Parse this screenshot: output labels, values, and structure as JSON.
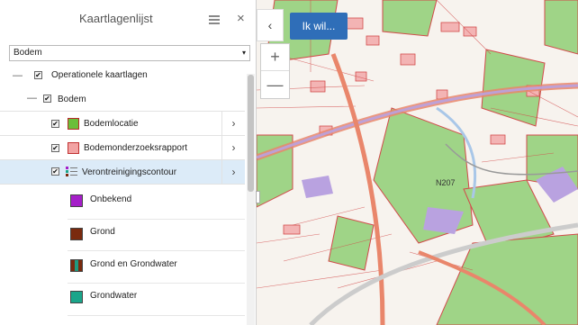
{
  "panel": {
    "title": "Kaartlagenlijst",
    "menu_icon": "menu-icon",
    "close_icon": "close-icon",
    "close_glyph": "×"
  },
  "select": {
    "value": "Bodem",
    "caret": "▾"
  },
  "tree": {
    "root": {
      "label": "Operationele kaartlagen",
      "checked": "✔"
    },
    "group": {
      "label": "Bodem",
      "checked": "✔"
    },
    "layers": [
      {
        "label": "Bodemlocatie",
        "checked": "✔",
        "color": "#6abf3a",
        "border": "#b8282a"
      },
      {
        "label": "Bodemonderzoeksrapport",
        "checked": "✔",
        "color": "#f2a3a3",
        "border": "#c13232"
      },
      {
        "label": "Verontreinigingscontour",
        "checked": "✔",
        "icon": "legend-list-icon"
      }
    ],
    "legend": [
      {
        "label": "Onbekend",
        "color": "#a51fc9"
      },
      {
        "label": "Grond",
        "color": "#7a2a0e"
      },
      {
        "label": "Grond en Grondwater",
        "color": "#7a2a0e",
        "color2": "#1f9a7f"
      },
      {
        "label": "Grondwater",
        "color": "#1aa58a"
      }
    ],
    "chevron": "›",
    "dash": "—"
  },
  "map": {
    "collapse_glyph": "‹",
    "ikwil_label": "Ik wil...",
    "zoom_in": "+",
    "zoom_out": "—",
    "road_label": "N207",
    "colors": {
      "background": "#f7f3ee",
      "green": "#9fd487",
      "red": "#d24a4a",
      "pink": "#f3b4b4",
      "purple": "#b9a2e0",
      "road": "#e9866b",
      "water": "#a9c7e8"
    }
  }
}
